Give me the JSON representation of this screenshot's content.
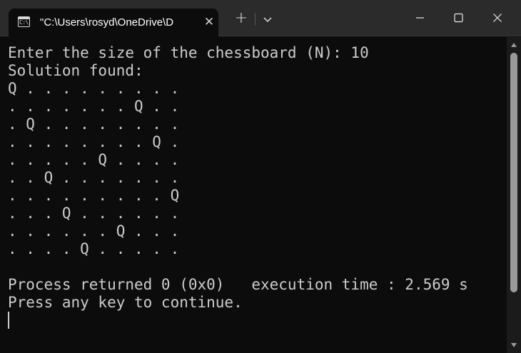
{
  "window": {
    "tab_title": "\"C:\\Users\\rosyd\\OneDrive\\D",
    "tab_icon_glyph": "C:\\",
    "tab_close_glyph": "✕",
    "new_tab_glyph": "+",
    "icons": {
      "tab": "terminal-icon",
      "close_tab": "close-icon",
      "new_tab": "plus-icon",
      "dropdown": "chevron-down-icon",
      "minimize": "minimize-icon",
      "maximize": "maximize-icon",
      "close": "close-icon"
    }
  },
  "console": {
    "lines": [
      "Enter the size of the chessboard (N): 10",
      "Solution found:",
      "Q . . . . . . . . .",
      ". . . . . . . Q . .",
      ". Q . . . . . . . .",
      ". . . . . . . . Q .",
      ". . . . . Q . . . .",
      ". . Q . . . . . . .",
      ". . . . . . . . . Q",
      ". . . Q . . . . . .",
      ". . . . . . Q . . .",
      ". . . . Q . . . . .",
      "",
      "Process returned 0 (0x0)   execution time : 2.569 s",
      "Press any key to continue."
    ]
  },
  "colors": {
    "background": "#0c0c0c",
    "titlebar": "#2b2b2b",
    "text": "#cccccc",
    "scrollbar_thumb": "#9a9a9a"
  }
}
